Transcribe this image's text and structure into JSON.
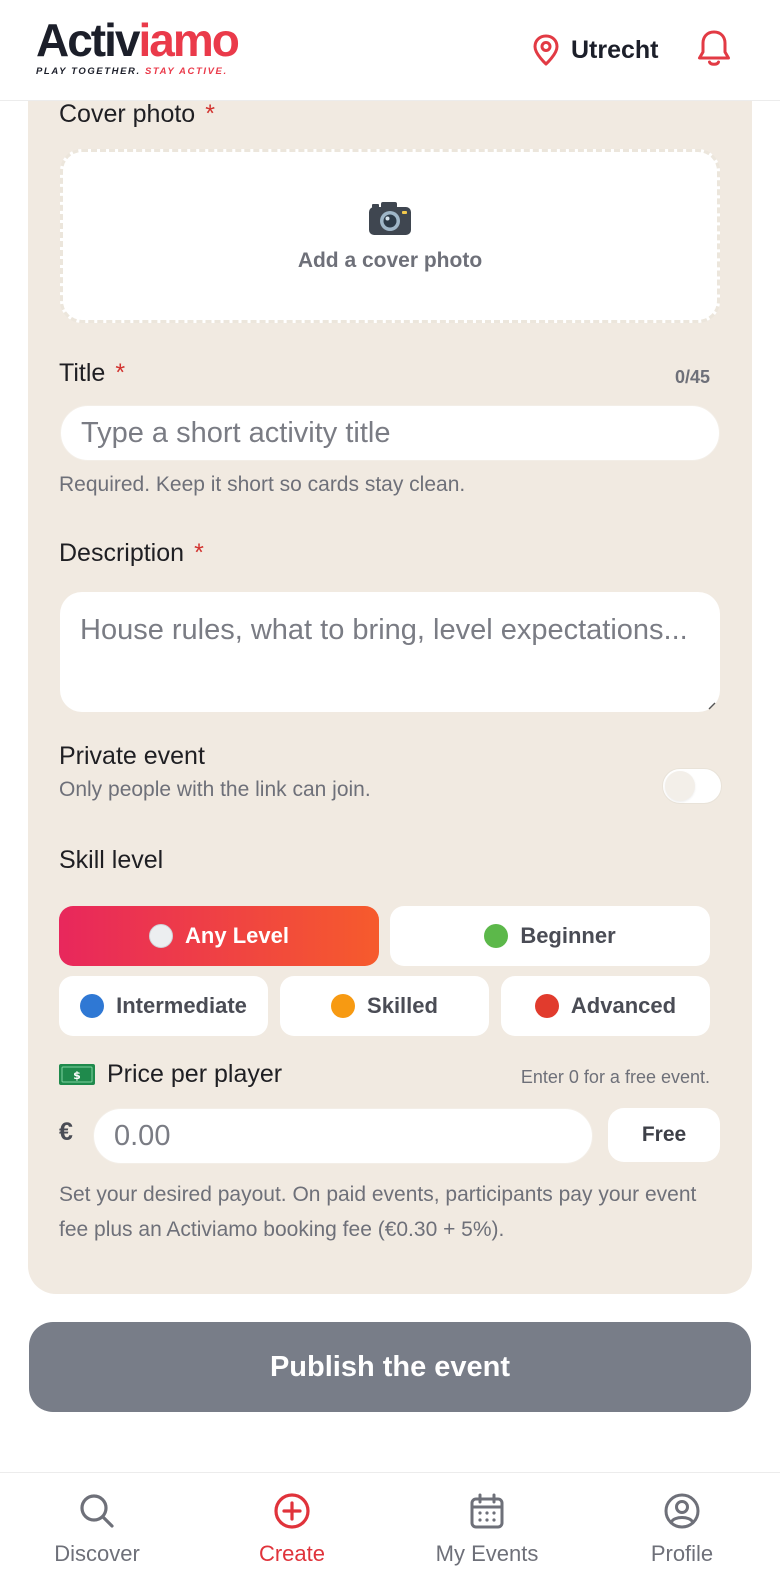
{
  "header": {
    "logo_part1": "Activ",
    "logo_part2": "iamo",
    "tagline_part1": "PLAY TOGETHER.",
    "tagline_part2": "STAY ACTIVE.",
    "location": "Utrecht",
    "location_icon": "map-pin-icon",
    "bell_icon": "bell-icon"
  },
  "form": {
    "cover": {
      "label": "Cover photo",
      "required_mark": "*",
      "drop_text": "Add a cover photo",
      "icon": "camera-icon"
    },
    "title": {
      "label": "Title",
      "required_mark": "*",
      "counter": "0/45",
      "placeholder": "Type a short activity title",
      "hint": "Required. Keep it short so cards stay clean."
    },
    "description": {
      "label": "Description",
      "required_mark": "*",
      "placeholder": "House rules, what to bring, level expectations..."
    },
    "private": {
      "label": "Private event",
      "hint": "Only people with the link can join.",
      "enabled": false
    },
    "skill": {
      "label": "Skill level",
      "options": [
        {
          "label": "Any Level",
          "color": "#eceef0",
          "selected": true
        },
        {
          "label": "Beginner",
          "color": "#5cb84a",
          "selected": false
        },
        {
          "label": "Intermediate",
          "color": "#2f78d4",
          "selected": false
        },
        {
          "label": "Skilled",
          "color": "#f79a12",
          "selected": false
        },
        {
          "label": "Advanced",
          "color": "#e13b2d",
          "selected": false
        }
      ]
    },
    "price": {
      "label": "Price per player",
      "icon": "cash-icon",
      "note": "Enter 0 for a free event.",
      "currency": "€",
      "placeholder": "0.00",
      "free_label": "Free",
      "hint": "Set your desired payout. On paid events, participants pay your event fee plus an Activiamo booking fee (€0.30 + 5%)."
    },
    "publish_label": "Publish the event"
  },
  "nav": {
    "items": [
      {
        "label": "Discover",
        "icon": "search-icon",
        "active": false
      },
      {
        "label": "Create",
        "icon": "plus-circle-icon",
        "active": true
      },
      {
        "label": "My Events",
        "icon": "calendar-icon",
        "active": false
      },
      {
        "label": "Profile",
        "icon": "user-circle-icon",
        "active": false
      }
    ]
  },
  "colors": {
    "brand_red": "#ea3a4a",
    "accent_gradient_start": "#e8275c",
    "accent_gradient_end": "#f65b2c",
    "card_bg": "#f1eae1",
    "publish_disabled": "#787d88"
  }
}
